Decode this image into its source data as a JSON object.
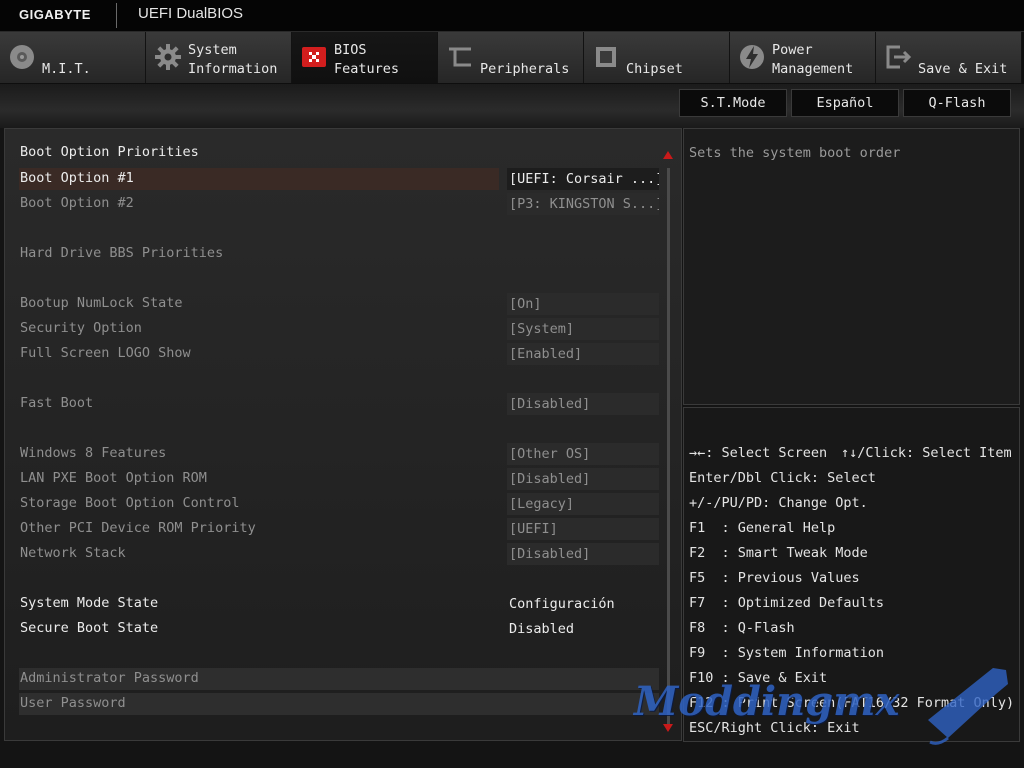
{
  "header": {
    "brand": "GIGABYTE",
    "product": "UEFI DualBIOS"
  },
  "tabs": [
    {
      "label": "M.I.T.",
      "icon": "gauge-disc-icon",
      "active": false
    },
    {
      "label": "System\nInformation",
      "icon": "gear-icon",
      "active": false
    },
    {
      "label": "BIOS\nFeatures",
      "icon": "bios-chip-icon",
      "active": true
    },
    {
      "label": "Peripherals",
      "icon": "peripherals-plug-icon",
      "active": false
    },
    {
      "label": "Chipset",
      "icon": "chipset-icon",
      "active": false
    },
    {
      "label": "Power\nManagement",
      "icon": "power-bolt-icon",
      "active": false
    },
    {
      "label": "Save & Exit",
      "icon": "exit-door-icon",
      "active": false
    }
  ],
  "subbar": {
    "st_mode": "S.T.Mode",
    "language": "Español",
    "qflash": "Q-Flash"
  },
  "main": {
    "section_title": "Boot Option Priorities",
    "items": {
      "boot1": {
        "label": "Boot Option #1",
        "value": "[UEFI: Corsair ...]"
      },
      "boot2": {
        "label": "Boot Option #2",
        "value": "[P3: KINGSTON S...]"
      },
      "hdd_bbs": {
        "label": "Hard Drive BBS Priorities"
      },
      "numlock": {
        "label": "Bootup NumLock State",
        "value": "[On]"
      },
      "security": {
        "label": "Security Option",
        "value": "[System]"
      },
      "logo": {
        "label": "Full Screen LOGO Show",
        "value": "[Enabled]"
      },
      "fastboot": {
        "label": "Fast Boot",
        "value": "[Disabled]"
      },
      "win8": {
        "label": "Windows 8 Features",
        "value": "[Other OS]"
      },
      "lanpxe": {
        "label": "LAN PXE Boot Option ROM",
        "value": "[Disabled]"
      },
      "storage": {
        "label": "Storage Boot Option Control",
        "value": "[Legacy]"
      },
      "otherpci": {
        "label": "Other PCI Device ROM Priority",
        "value": "[UEFI]"
      },
      "netstack": {
        "label": "Network Stack",
        "value": "[Disabled]"
      },
      "sysmode": {
        "label": "System Mode State",
        "value": "Configuración"
      },
      "secureboot": {
        "label": "Secure Boot State",
        "value": "Disabled"
      },
      "adminpw": {
        "label": "Administrator Password"
      },
      "userpw": {
        "label": "User Password"
      }
    }
  },
  "help": {
    "text": "Sets the system boot order"
  },
  "keys": {
    "l1a": "→←: Select Screen",
    "l1b": "↑↓/Click: Select Item",
    "l2": "Enter/Dbl Click: Select",
    "l3": "+/-/PU/PD: Change Opt.",
    "l4": "F1  : General Help",
    "l5": "F2  : Smart Tweak Mode",
    "l6": "F5  : Previous Values",
    "l7": "F7  : Optimized Defaults",
    "l8": "F8  : Q-Flash",
    "l9": "F9  : System Information",
    "l10": "F10 : Save & Exit",
    "l11": "F12 : Print Screen(FAT16/32 Format Only)",
    "l12": "ESC/Right Click: Exit"
  },
  "watermark": {
    "text": "Moddingmx"
  },
  "colors": {
    "accent": "#c81a1a",
    "selected_row": "#3a2a25",
    "watermark": "#2f63c4"
  }
}
